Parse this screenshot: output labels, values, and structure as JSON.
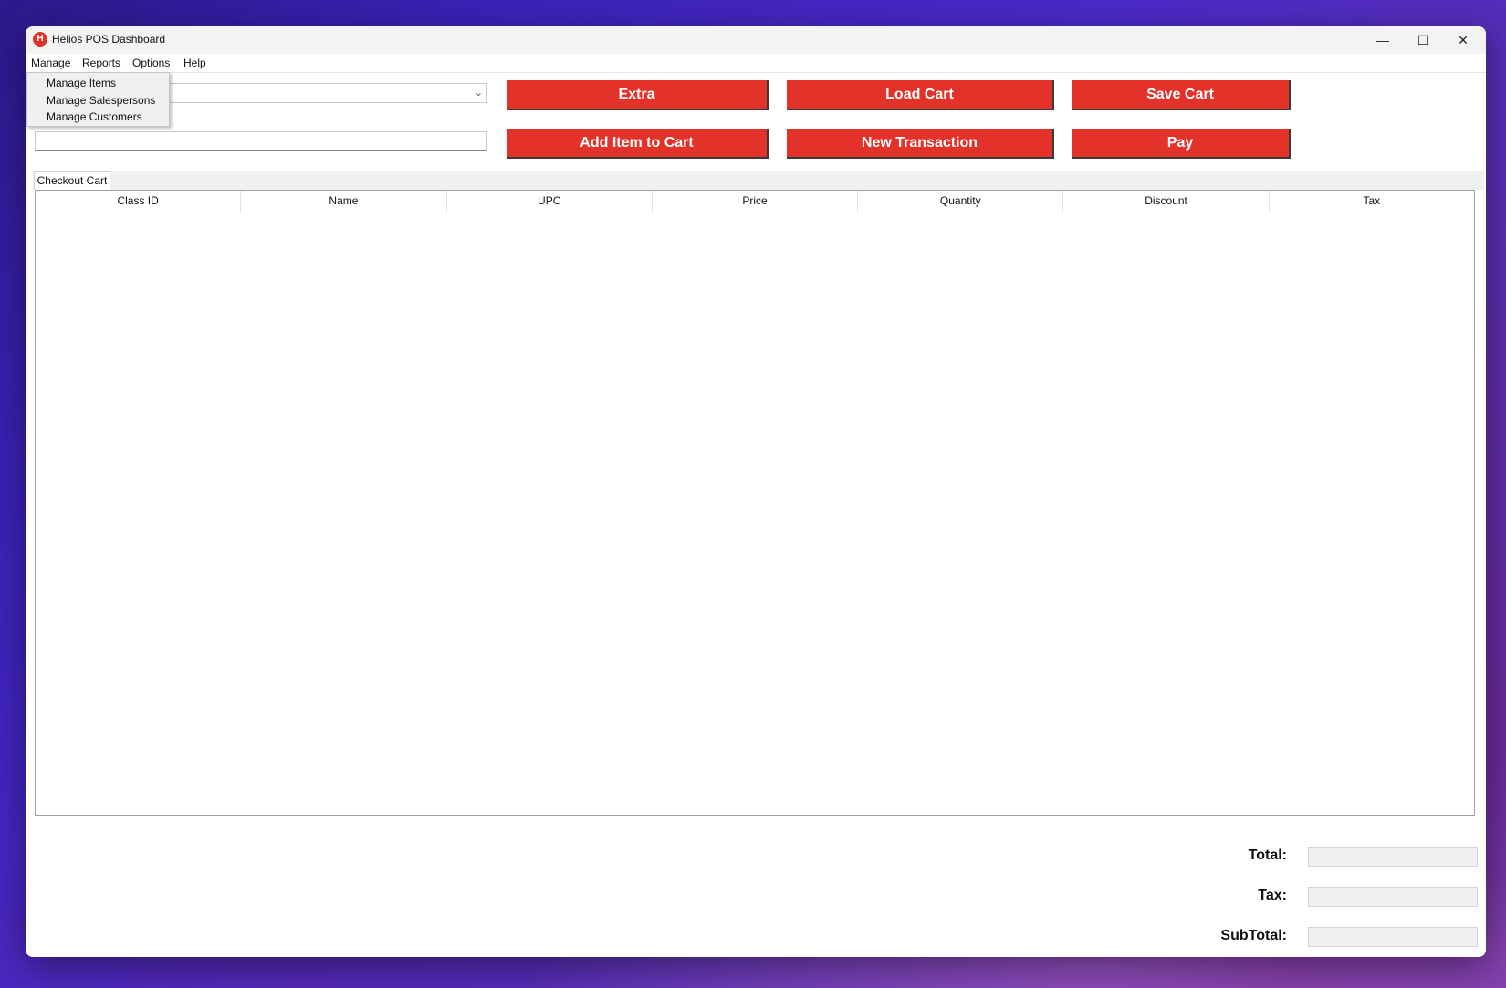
{
  "window": {
    "title": "Helios POS Dashboard",
    "icon_letter": "H",
    "minimize_glyph": "—",
    "maximize_glyph": "☐",
    "close_glyph": "✕"
  },
  "menubar": {
    "items": [
      "Manage",
      "Reports",
      "Options",
      "Help"
    ]
  },
  "manage_menu": {
    "items": [
      "Manage Items",
      "Manage Salespersons",
      "Manage Customers"
    ]
  },
  "form": {
    "combo_value": "",
    "text_value": ""
  },
  "buttons": {
    "extra": "Extra",
    "load_cart": "Load Cart",
    "save_cart": "Save Cart",
    "add_item": "Add Item to Cart",
    "new_transaction": "New Transaction",
    "pay": "Pay"
  },
  "cart": {
    "tab_label": "Checkout Cart",
    "columns": [
      "Class ID",
      "Name",
      "UPC",
      "Price",
      "Quantity",
      "Discount",
      "Tax"
    ],
    "rows": []
  },
  "summary": {
    "total_label": "Total:",
    "tax_label": "Tax:",
    "subtotal_label": "SubTotal:",
    "total_value": "",
    "tax_value": "",
    "subtotal_value": ""
  },
  "colors": {
    "accent_red": "#e3322a"
  }
}
